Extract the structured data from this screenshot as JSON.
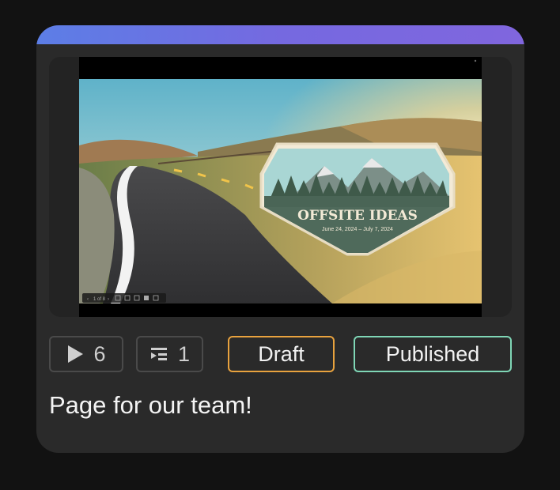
{
  "card": {
    "description": "Page for our team!",
    "accent_colors": [
      "#5c7ee6",
      "#8066de"
    ]
  },
  "thumbnail": {
    "badge_title": "OFFSITE IDEAS",
    "badge_dates": "June 24, 2024 – July 7, 2024",
    "player_page": "1 of 8"
  },
  "stats": {
    "plays_icon": "play-icon",
    "plays": "6",
    "queue_icon": "playlist-icon",
    "queue": "1"
  },
  "status": {
    "draft_label": "Draft",
    "draft_color": "#e8a23e",
    "published_label": "Published",
    "published_color": "#7fd6b6"
  }
}
